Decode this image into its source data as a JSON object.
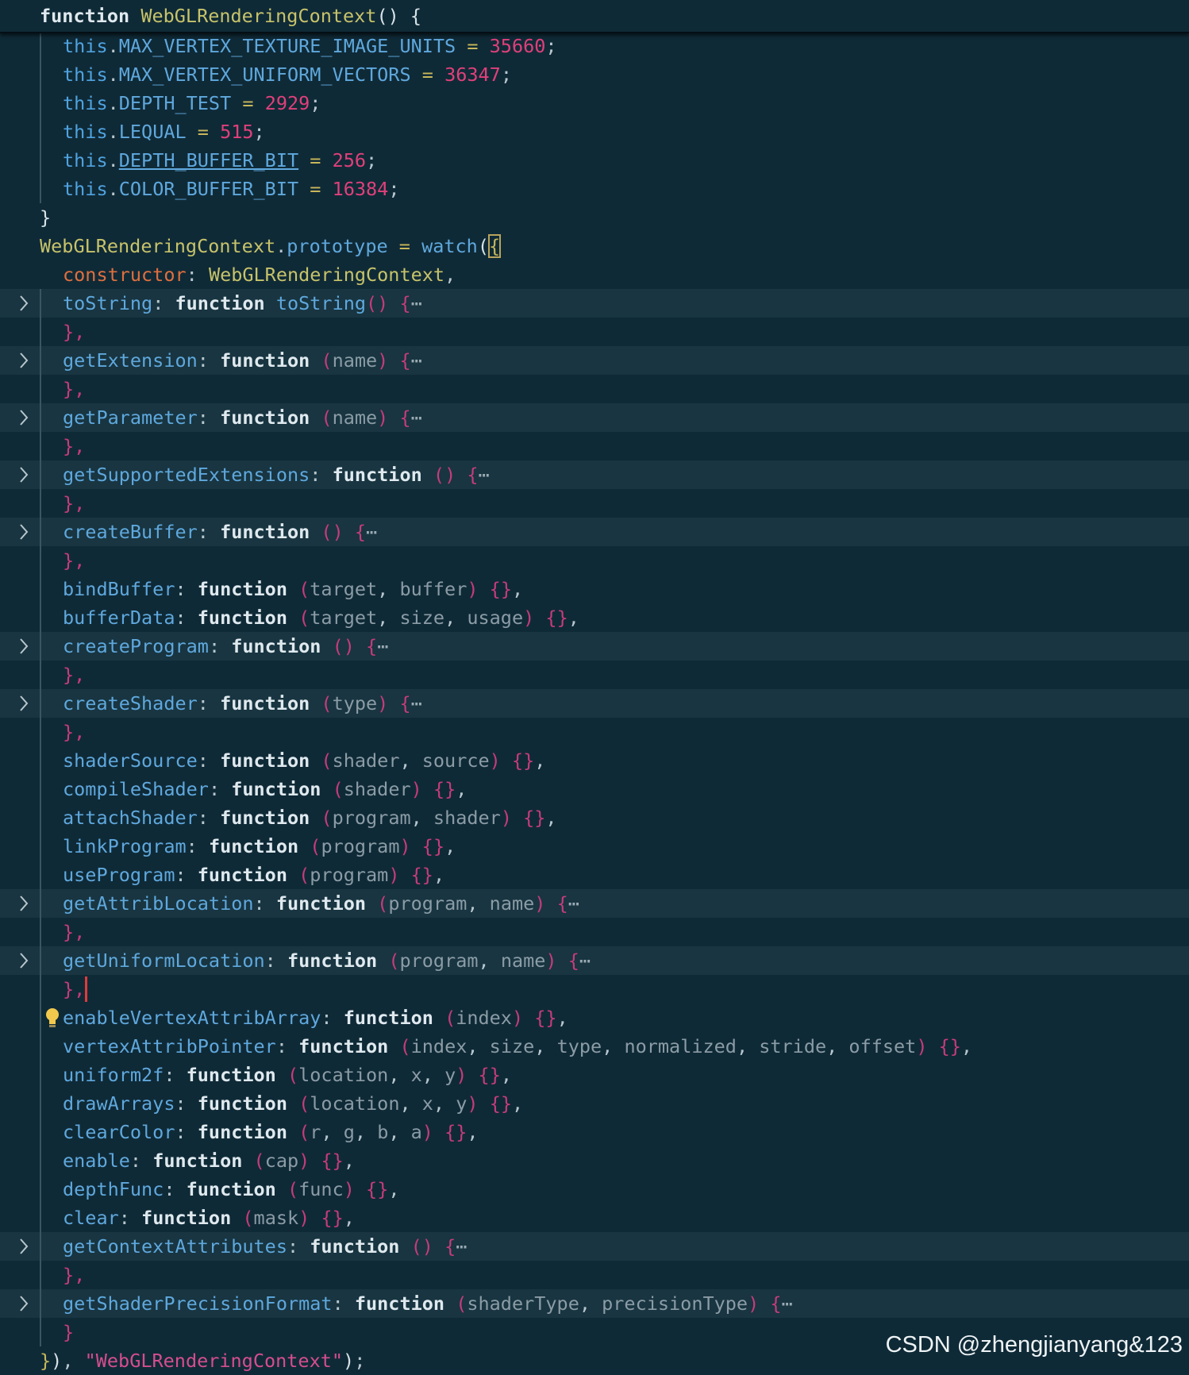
{
  "sticky_header": {
    "keyword": "function",
    "name": "WebGLRenderingContext",
    "rest": "() {"
  },
  "constants": [
    {
      "name": "MAX_VERTEX_TEXTURE_IMAGE_UNITS",
      "value": "35660"
    },
    {
      "name": "MAX_VERTEX_UNIFORM_VECTORS",
      "value": "36347"
    },
    {
      "name": "DEPTH_TEST",
      "value": "2929"
    },
    {
      "name": "LEQUAL",
      "value": "515"
    },
    {
      "name": "DEPTH_BUFFER_BIT",
      "value": "256"
    },
    {
      "name": "COLOR_BUFFER_BIT",
      "value": "16384"
    }
  ],
  "proto": {
    "object": "WebGLRenderingContext",
    "property": "prototype",
    "callee": "watch",
    "constructor_key": "constructor",
    "constructor_value": "WebGLRenderingContext",
    "closing_label": "\"WebGLRenderingContext\""
  },
  "members": [
    {
      "name": "toString",
      "fname": "toString",
      "params": "",
      "folded": true
    },
    {
      "name": "getExtension",
      "params": "name",
      "folded": true
    },
    {
      "name": "getParameter",
      "params": "name",
      "folded": true
    },
    {
      "name": "getSupportedExtensions",
      "params": "",
      "folded": true
    },
    {
      "name": "createBuffer",
      "params": "",
      "folded": true
    },
    {
      "name": "bindBuffer",
      "params": "target, buffer",
      "folded": false
    },
    {
      "name": "bufferData",
      "params": "target, size, usage",
      "folded": false
    },
    {
      "name": "createProgram",
      "params": "",
      "folded": true
    },
    {
      "name": "createShader",
      "params": "type",
      "folded": true
    },
    {
      "name": "shaderSource",
      "params": "shader, source",
      "folded": false
    },
    {
      "name": "compileShader",
      "params": "shader",
      "folded": false
    },
    {
      "name": "attachShader",
      "params": "program, shader",
      "folded": false
    },
    {
      "name": "linkProgram",
      "params": "program",
      "folded": false
    },
    {
      "name": "useProgram",
      "params": "program",
      "folded": false
    },
    {
      "name": "getAttribLocation",
      "params": "program, name",
      "folded": true
    },
    {
      "name": "getUniformLocation",
      "params": "program, name",
      "folded": true,
      "cursor": true
    },
    {
      "name": "enableVertexAttribArray",
      "params": "index",
      "folded": false,
      "bulb": true
    },
    {
      "name": "vertexAttribPointer",
      "params": "index, size, type, normalized, stride, offset",
      "folded": false
    },
    {
      "name": "uniform2f",
      "params": "location, x, y",
      "folded": false
    },
    {
      "name": "drawArrays",
      "params": "location, x, y",
      "folded": false
    },
    {
      "name": "clearColor",
      "params": "r, g, b, a",
      "folded": false
    },
    {
      "name": "enable",
      "params": "cap",
      "folded": false
    },
    {
      "name": "depthFunc",
      "params": "func",
      "folded": false
    },
    {
      "name": "clear",
      "params": "mask",
      "folded": false
    },
    {
      "name": "getContextAttributes",
      "params": "",
      "folded": true
    },
    {
      "name": "getShaderPrecisionFormat",
      "params": "shaderType, precisionType",
      "folded": true,
      "last": true
    }
  ],
  "tokens": {
    "function_kw": "function",
    "this_kw": "this",
    "ellipsis": "⋯"
  },
  "icons": {
    "fold": "chevron-right-icon",
    "lightbulb": "lightbulb-icon"
  },
  "watermark": "CSDN @zhengjianyang&123",
  "colors": {
    "background": "#0f2a37",
    "folded_line": "#183541",
    "keyword": "#dfe9ee",
    "function_name": "#c7c36a",
    "property": "#5fa8dd",
    "number": "#e0407a",
    "paren": "#c63c7a",
    "param": "#8b9ca5",
    "constructor": "#df6f3e"
  }
}
